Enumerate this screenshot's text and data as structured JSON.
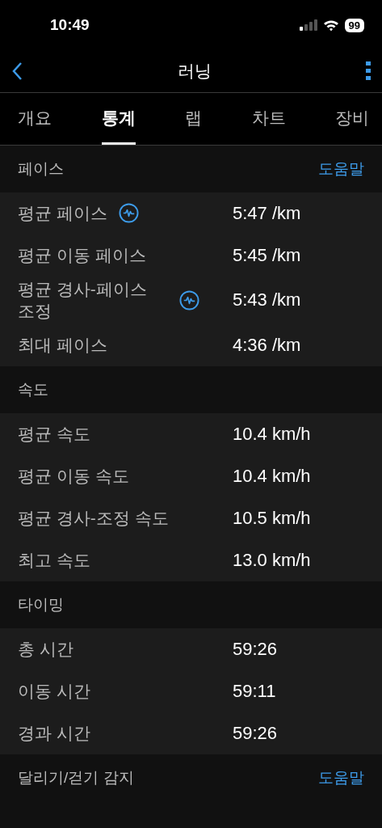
{
  "status_bar": {
    "time": "10:49",
    "battery": "99"
  },
  "nav": {
    "title": "러닝"
  },
  "tabs": [
    {
      "label": "개요",
      "selected": false
    },
    {
      "label": "통계",
      "selected": true
    },
    {
      "label": "랩",
      "selected": false
    },
    {
      "label": "차트",
      "selected": false
    },
    {
      "label": "장비",
      "selected": false
    }
  ],
  "sections": [
    {
      "title": "페이스",
      "help": "도움말",
      "rows": [
        {
          "label": "평균 페이스",
          "value": "5:47 /km",
          "kind": "chart-link"
        },
        {
          "label": "평균 이동 페이스",
          "value": "5:45 /km",
          "kind": "plain"
        },
        {
          "label": "평균 경사-페이스 조정",
          "value": "5:43 /km",
          "kind": "chart-link"
        },
        {
          "label": "최대 페이스",
          "value": "4:36 /km",
          "kind": "plain"
        }
      ]
    },
    {
      "title": "속도",
      "rows": [
        {
          "label": "평균 속도",
          "value": "10.4 km/h",
          "kind": "plain"
        },
        {
          "label": "평균 이동 속도",
          "value": "10.4 km/h",
          "kind": "plain"
        },
        {
          "label": "평균 경사-조정 속도",
          "value": "10.5 km/h",
          "kind": "plain"
        },
        {
          "label": "최고 속도",
          "value": "13.0 km/h",
          "kind": "plain"
        }
      ]
    },
    {
      "title": "타이밍",
      "rows": [
        {
          "label": "총 시간",
          "value": "59:26",
          "kind": "plain"
        },
        {
          "label": "이동 시간",
          "value": "59:11",
          "kind": "plain"
        },
        {
          "label": "경과 시간",
          "value": "59:26",
          "kind": "plain"
        }
      ]
    },
    {
      "title": "달리기/걷기 감지",
      "help": "도움말"
    }
  ]
}
